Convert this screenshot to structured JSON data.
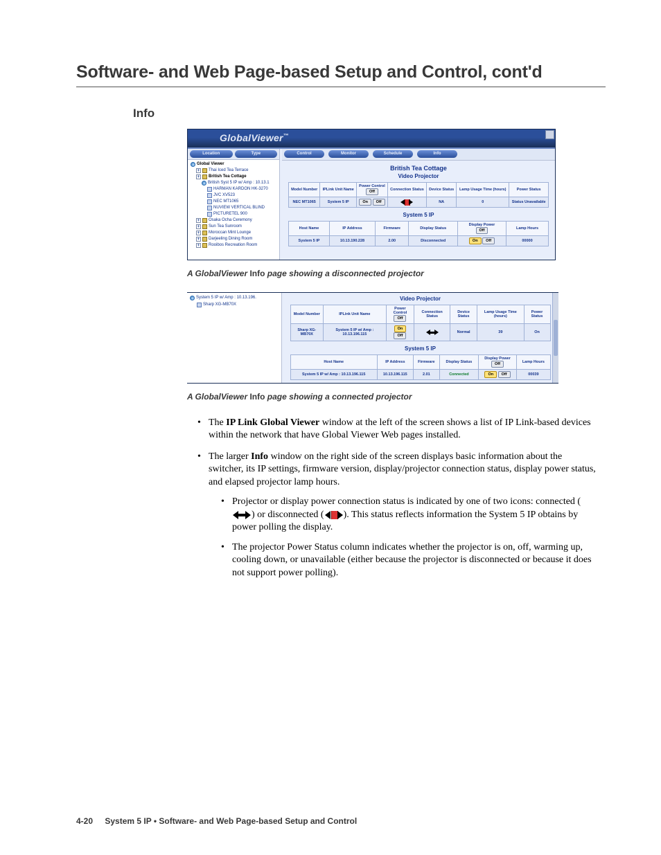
{
  "chapter_title": "Software- and Web Page-based Setup and Control, cont'd",
  "section_title": "Info",
  "shot1": {
    "brand": "GlobalViewer",
    "brand_tm": "™",
    "sidebar_pills": {
      "left": "Location",
      "right": "Type"
    },
    "tree": [
      {
        "indent": 0,
        "icon": "globe",
        "label": "Global Viewer",
        "bold": true
      },
      {
        "indent": 1,
        "icon": "folder",
        "label": "Thai Iced Tea Terrace"
      },
      {
        "indent": 1,
        "icon": "folder",
        "label": "British Tea Cottage",
        "bold": true
      },
      {
        "indent": 2,
        "icon": "globe",
        "label": "British Syst 5 IP w/ Amp : 10.13.1"
      },
      {
        "indent": 3,
        "icon": "dev",
        "label": "HARMAN KARDON HK-3270"
      },
      {
        "indent": 3,
        "icon": "dev",
        "label": "JVC XV523"
      },
      {
        "indent": 3,
        "icon": "dev",
        "label": "NEC MT1065"
      },
      {
        "indent": 3,
        "icon": "dev",
        "label": "NUVIEW VERTICAL BLIND"
      },
      {
        "indent": 3,
        "icon": "dev",
        "label": "PICTURETEL 900"
      },
      {
        "indent": 1,
        "icon": "folder",
        "label": "Osaka Ocha Ceremony"
      },
      {
        "indent": 1,
        "icon": "folder",
        "label": "Sun Tea Sunroom"
      },
      {
        "indent": 1,
        "icon": "folder",
        "label": "Moroccan Mint Lounge"
      },
      {
        "indent": 1,
        "icon": "folder",
        "label": "Darjeeling Dining Room"
      },
      {
        "indent": 1,
        "icon": "folder",
        "label": "Rooibos Recreation Room"
      }
    ],
    "tabs": [
      "Control",
      "Monitor",
      "Schedule",
      "Info"
    ],
    "room_title": "British Tea Cottage",
    "sub_title": "Video Projector",
    "table1_headers": [
      "Model Number",
      "IPLink Unit Name",
      "Power Control",
      "Connection Status",
      "Device Status",
      "Lamp Usage Time (hours)",
      "Power Status"
    ],
    "table1_row": {
      "model": "NEC MT1065",
      "unit": "System 5 IP",
      "btn_on": "On",
      "btn_off": "Off",
      "device_status": "NA",
      "lamp": "0",
      "power": "Status Unavailable"
    },
    "section2_title": "System 5 IP",
    "table2_headers": [
      "Host Name",
      "IP Address",
      "Firmware",
      "Display Status",
      "Display Power",
      "Lamp Hours"
    ],
    "table2_row": {
      "host": "System 5 IP",
      "ip": "10.13.190.228",
      "fw": "2.00",
      "disp_status": "Disconnected",
      "btn_on": "On",
      "btn_off": "Off",
      "lamp": "00000"
    }
  },
  "caption1": {
    "pre": "A GlobalViewer ",
    "bold1": "Info",
    "post": " page showing a disconnected projector"
  },
  "shot2": {
    "tree": [
      {
        "icon": "globe",
        "label": "System 5 IP w/ Amp : 10.13.196."
      },
      {
        "icon": "dev",
        "label": "Sharp XG-MB70X"
      }
    ],
    "sub_title": "Video Projector",
    "table1_headers": [
      "Model Number",
      "IPLink Unit Name",
      "Power Control",
      "Connection Status",
      "Device Status",
      "Lamp Usage Time (hours)",
      "Power Status"
    ],
    "table1_row": {
      "model": "Sharp XG-MB70X",
      "unit": "System 5 IP w/ Amp : 10.13.196.115",
      "btn_on": "On",
      "btn_off": "Off",
      "device_status": "Normal",
      "lamp": "39",
      "power": "On"
    },
    "section2_title": "System 5 IP",
    "table2_headers": [
      "Host Name",
      "IP Address",
      "Firmware",
      "Display Status",
      "Display Power",
      "Lamp Hours"
    ],
    "table2_row": {
      "host": "System 5 IP w/ Amp : 10.13.196.115",
      "ip": "10.13.196.115",
      "fw": "2.01",
      "disp_status": "Connected",
      "btn_on": "On",
      "btn_off": "Off",
      "lamp": "00039"
    }
  },
  "caption2": {
    "pre": "A GlobalViewer ",
    "bold1": "Info",
    "post": " page showing a connected projector"
  },
  "bullets": {
    "b1a": "The ",
    "b1b": "IP Link Global Viewer",
    "b1c": " window at the left of the screen shows a list of IP Link-based devices within the network that have Global Viewer Web pages installed.",
    "b2a": "The larger ",
    "b2b": "Info",
    "b2c": " window on the right side of the screen displays basic information about the switcher, its IP settings, firmware version, display/projector connection status, display power status, and elapsed projector lamp hours.",
    "s1a": "Projector or display power connection status is indicated by one of two icons: connected (",
    "s1b": ") or disconnected (",
    "s1c": ").  This status reflects information the System 5 IP obtains by power polling the display.",
    "s2": "The projector Power Status column indicates whether the projector is on, off, warming up, cooling down, or unavailable (either because the projector is disconnected or because it does not support power polling)."
  },
  "footer": {
    "page": "4-20",
    "text": "System 5 IP • Software- and Web Page-based Setup and Control"
  }
}
